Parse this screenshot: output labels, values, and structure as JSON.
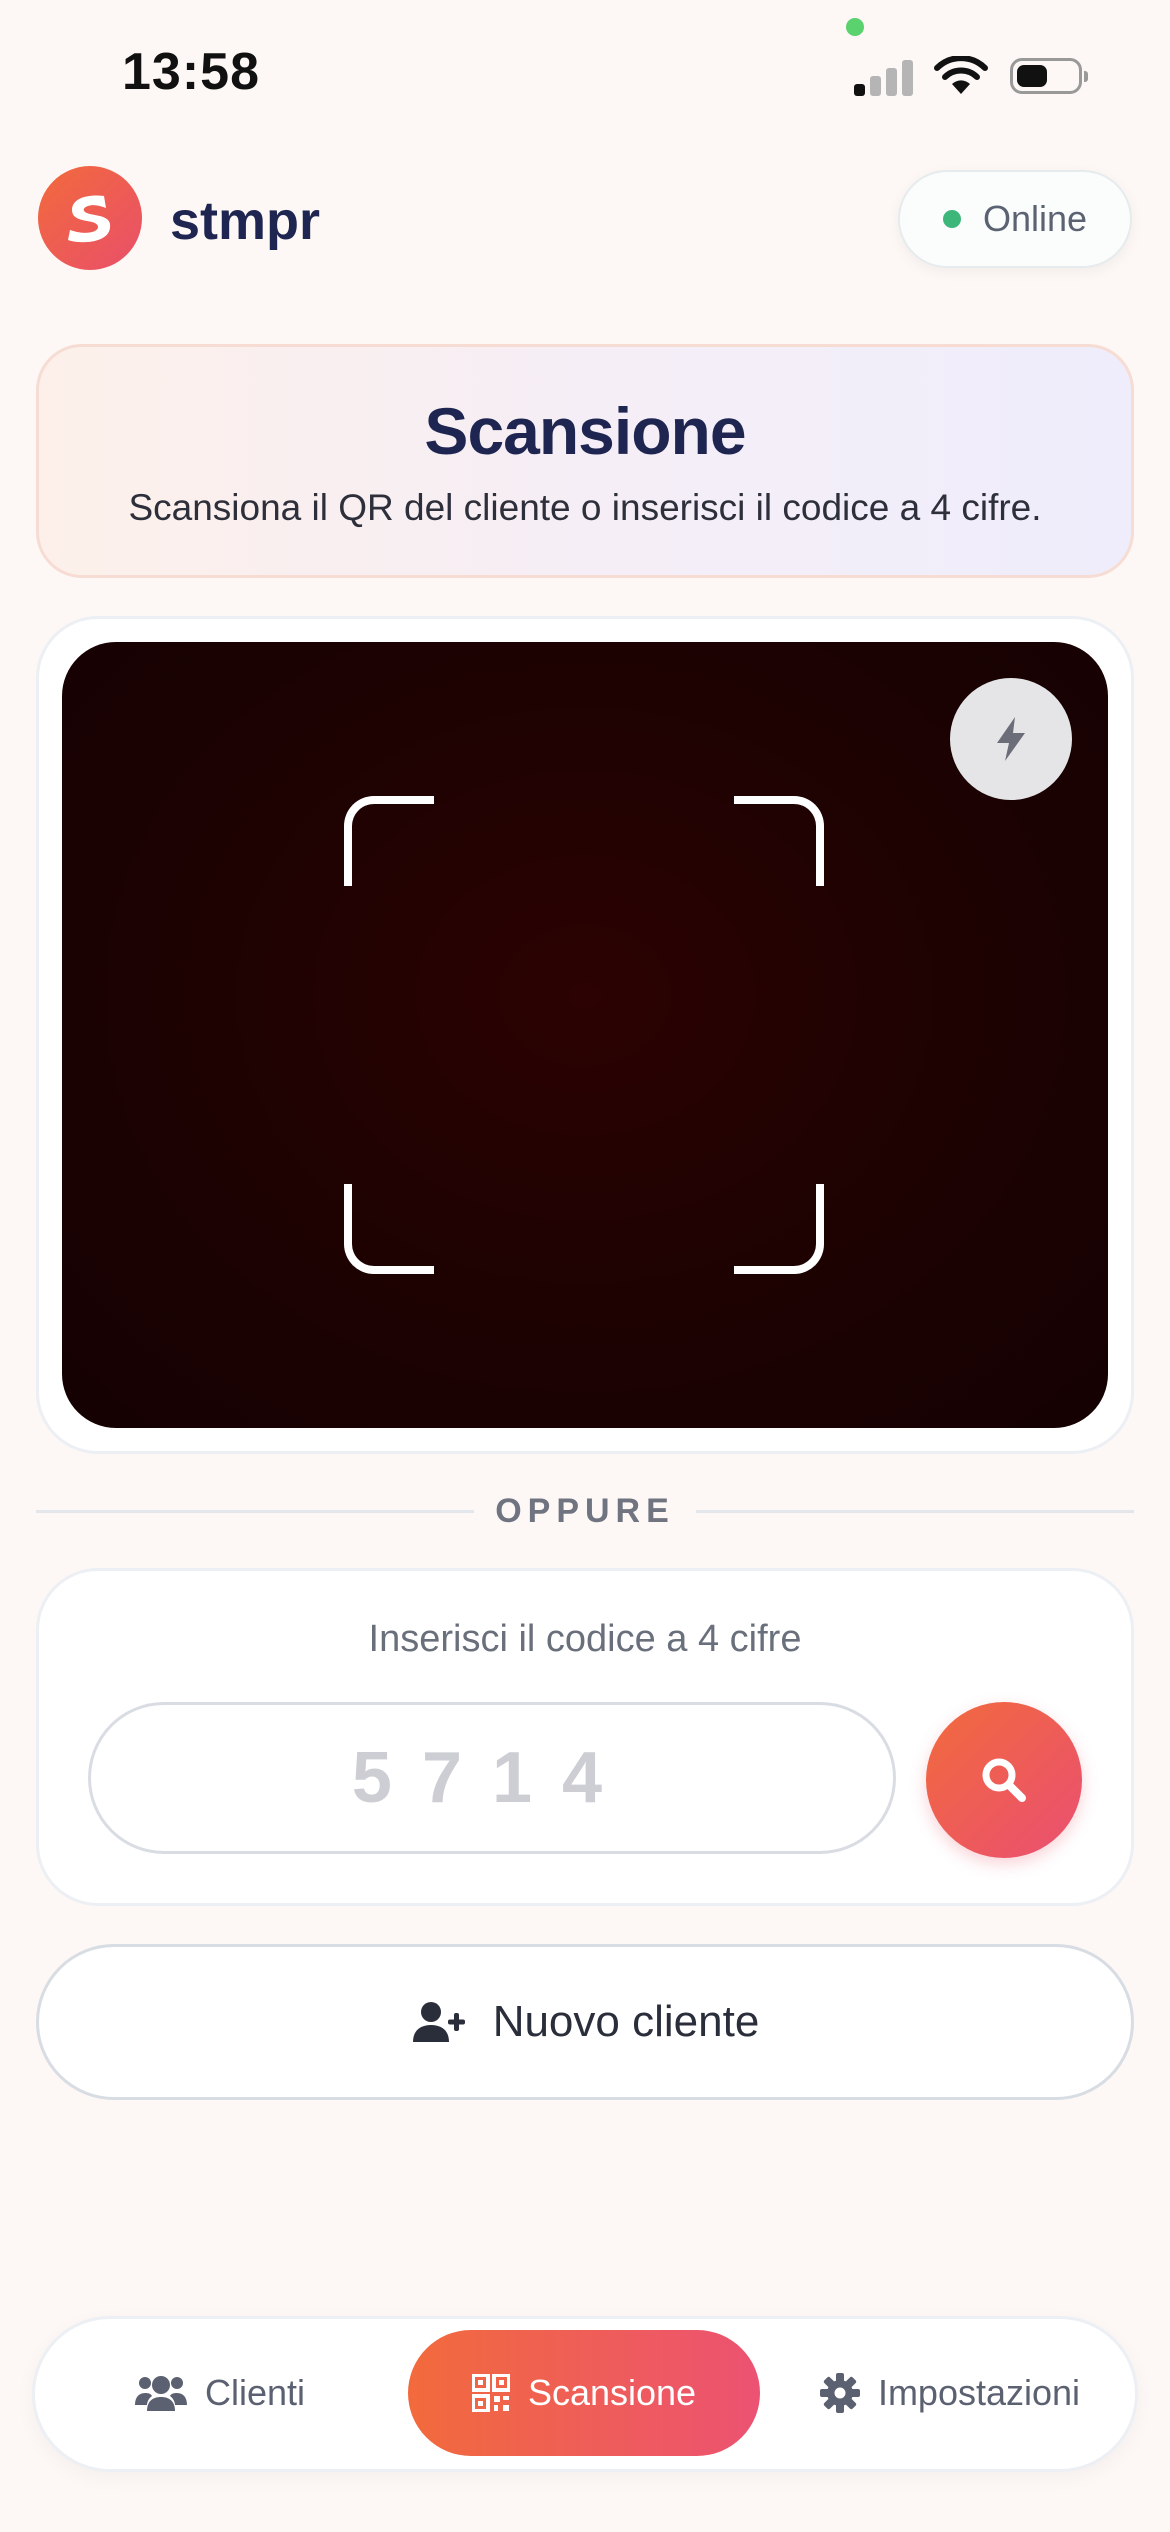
{
  "status_bar": {
    "time": "13:58"
  },
  "header": {
    "brand": "stmpr",
    "logo_icon": "stmpr-logo-icon",
    "status_label": "Online",
    "status_color": "#3db67a"
  },
  "title_card": {
    "title": "Scansione",
    "subtitle": "Scansiona il QR del cliente o inserisci il codice a 4 cifre."
  },
  "scanner": {
    "flash_icon": "flash-icon"
  },
  "divider": {
    "label": "OPPURE"
  },
  "code_entry": {
    "label": "Inserisci il codice a 4 cifre",
    "placeholder": "5714",
    "value": "",
    "search_icon": "search-icon"
  },
  "new_client": {
    "label": "Nuovo cliente",
    "icon": "user-plus-icon"
  },
  "bottom_nav": {
    "items": [
      {
        "label": "Clienti",
        "icon": "users-icon",
        "active": false
      },
      {
        "label": "Scansione",
        "icon": "qr-code-icon",
        "active": true
      },
      {
        "label": "Impostazioni",
        "icon": "gear-icon",
        "active": false
      }
    ]
  },
  "colors": {
    "accent_start": "#f26a3c",
    "accent_end": "#ea4f72",
    "navy": "#1e2550",
    "background": "#fdf8f5"
  }
}
